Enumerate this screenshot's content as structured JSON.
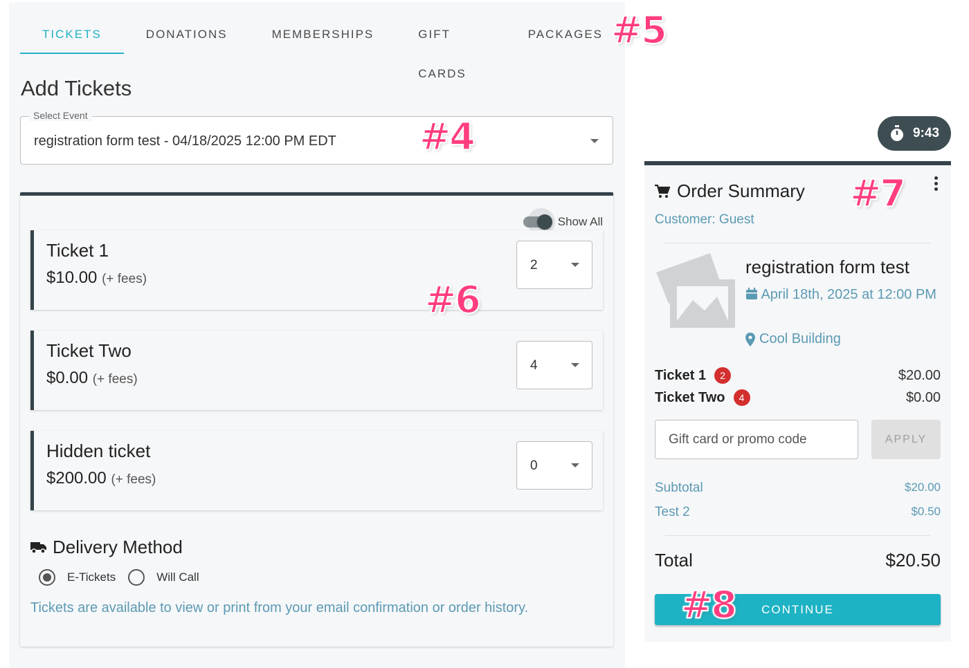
{
  "tabs": [
    "TICKETS",
    "DONATIONS",
    "MEMBERSHIPS",
    "GIFT CARDS",
    "PACKAGES"
  ],
  "page_title": "Add Tickets",
  "select_event": {
    "legend": "Select Event",
    "value": "registration form test - 04/18/2025 12:00 PM EDT"
  },
  "show_all_label": "Show All",
  "tickets": [
    {
      "name": "Ticket 1",
      "price": "$10.00",
      "fees": "(+ fees)",
      "qty": "2"
    },
    {
      "name": "Ticket Two",
      "price": "$0.00",
      "fees": "(+ fees)",
      "qty": "4"
    },
    {
      "name": "Hidden ticket",
      "price": "$200.00",
      "fees": "(+ fees)",
      "qty": "0"
    }
  ],
  "delivery": {
    "title": "Delivery Method",
    "options": [
      "E-Tickets",
      "Will Call"
    ],
    "selected": "E-Tickets",
    "note": "Tickets are available to view or print from your email confirmation or order history."
  },
  "timer": "9:43",
  "summary": {
    "title": "Order Summary",
    "customer": "Customer: Guest",
    "event_name": "registration form test",
    "event_date": "April 18th, 2025 at 12:00 PM",
    "event_location": "Cool Building",
    "items": [
      {
        "name": "Ticket 1",
        "count": "2",
        "amount": "$20.00"
      },
      {
        "name": "Ticket Two",
        "count": "4",
        "amount": "$0.00"
      }
    ],
    "promo_placeholder": "Gift card or promo code",
    "apply_label": "APPLY",
    "subtotal_label": "Subtotal",
    "subtotal": "$20.00",
    "fee_label": "Test 2",
    "fee": "$0.50",
    "total_label": "Total",
    "total": "$20.50",
    "continue_label": "CONTINUE"
  },
  "markers": [
    "#5",
    "#4",
    "#6",
    "#7",
    "#8"
  ],
  "colors": {
    "accent": "#1eb3c4",
    "dark": "#34434a",
    "link": "#5b9ab3",
    "badge": "#d32f2f",
    "marker": "#ff3d7f"
  }
}
